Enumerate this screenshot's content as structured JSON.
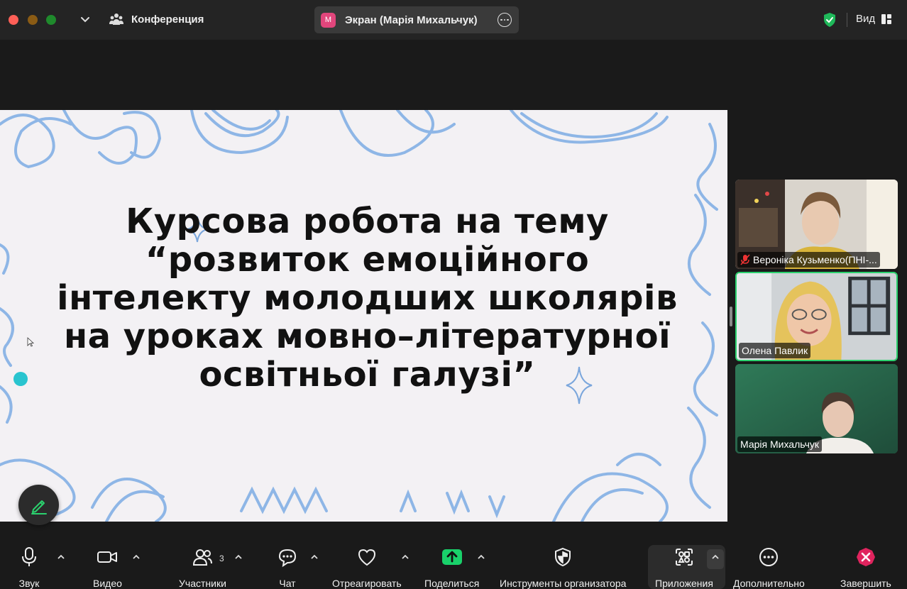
{
  "titlebar": {
    "conference_label": "Конференция",
    "screen_badge": "М",
    "screen_label": "Экран (Марія Михальчук)",
    "view_label": "Вид"
  },
  "slide": {
    "title": "Курсова робота на тему\n“розвиток емоційного\nінтелекту молодших школярів\nна уроках мовно–літературної\nосвітньої  галузі”"
  },
  "participants": [
    {
      "name": "Вероніка Кузьменко(ПНІ-...",
      "muted": true
    },
    {
      "name": "Олена Павлик",
      "muted": false,
      "active_speaker": true
    },
    {
      "name": "Марія Михальчук",
      "muted": false
    }
  ],
  "toolbar": {
    "audio": "Звук",
    "video": "Видео",
    "participants": "Участники",
    "participants_count": "3",
    "chat": "Чат",
    "react": "Отреагировать",
    "share": "Поделиться",
    "host_tools": "Инструменты организатора",
    "apps": "Приложения",
    "more": "Дополнительно",
    "end": "Завершить"
  },
  "colors": {
    "share_green": "#19d16a",
    "end_red": "#e0245e",
    "active_speaker_border": "#2bd16e",
    "scribble_blue": "#8eb6e6"
  }
}
